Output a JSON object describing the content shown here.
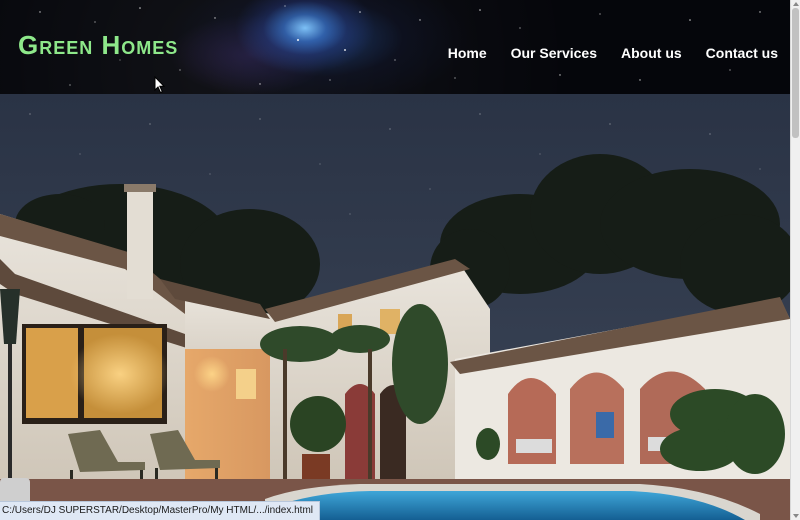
{
  "brand": {
    "logo_text": "Green Homes"
  },
  "nav": {
    "items": [
      {
        "label": "Home"
      },
      {
        "label": "Our Services"
      },
      {
        "label": "About us"
      },
      {
        "label": "Contact us"
      }
    ]
  },
  "statusbar": {
    "url": "C:/Users/DJ SUPERSTAR/Desktop/MasterPro/My HTML/.../index.html"
  },
  "colors": {
    "logo": "#8ee88a",
    "nav_text": "#ffffff",
    "header_bg": "#05060b",
    "night_sky": "#2b3446",
    "pool_water": "#1c7bb3",
    "tile_roof": "#6b5545"
  },
  "icons": {
    "cursor": "mouse-pointer-icon"
  }
}
